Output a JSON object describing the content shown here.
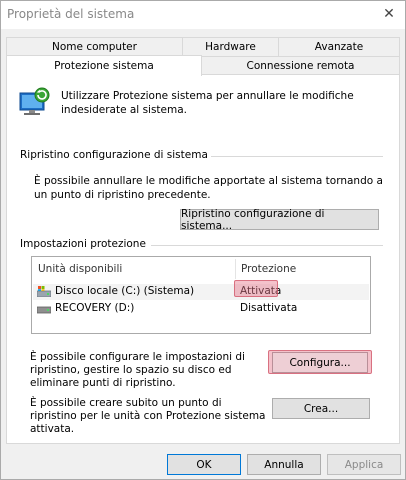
{
  "window": {
    "title": "Proprietà del sistema",
    "close_glyph": "✕"
  },
  "tabs": {
    "row1": [
      "Nome computer",
      "Hardware",
      "Avanzate"
    ],
    "row2": [
      "Protezione sistema",
      "Connessione remota"
    ],
    "active": "Protezione sistema"
  },
  "intro": {
    "text": "Utilizzare Protezione sistema per annullare le modifiche indesiderate al sistema."
  },
  "restore": {
    "heading": "Ripristino configurazione di sistema",
    "text": "È possibile annullare le modifiche apportate al sistema tornando a un punto di ripristino precedente.",
    "button_label": "Ripristino configurazione di sistema..."
  },
  "protection": {
    "heading": "Impostazioni protezione",
    "columns": [
      "Unità disponibili",
      "Protezione"
    ],
    "drives": [
      {
        "name": "Disco locale (C:) (Sistema)",
        "status": "Attivata",
        "icon": "system-drive-icon"
      },
      {
        "name": "RECOVERY (D:)",
        "status": "Disattivata",
        "icon": "drive-icon"
      }
    ],
    "configure_text": "È possibile configurare le impostazioni di ripristino, gestire lo spazio su disco ed eliminare punti di ripristino.",
    "configure_label": "Configura...",
    "create_text": "È possibile creare subito un punto di ripristino per le unità con Protezione sistema attivata.",
    "create_label": "Crea..."
  },
  "footer": {
    "ok": "OK",
    "cancel": "Annulla",
    "apply": "Applica"
  },
  "colors": {
    "highlight": "#e6788c",
    "focus_border": "#0078d7"
  }
}
